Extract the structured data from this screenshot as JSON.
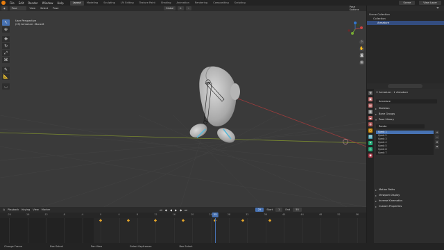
{
  "topbar": {
    "menus": [
      "File",
      "Edit",
      "Render",
      "Window",
      "Help"
    ],
    "workspaces": [
      "Layout",
      "Modeling",
      "Sculpting",
      "UV Editing",
      "Texture Paint",
      "Shading",
      "Animation",
      "Rendering",
      "Compositing",
      "Scripting"
    ],
    "active_workspace": "Layout",
    "scene": "Scene",
    "view_layer": "View Layer"
  },
  "viewport": {
    "mode": "Pose Mode",
    "menus": [
      "View",
      "Select",
      "Pose"
    ],
    "orientation": "Global",
    "view_name": "User Perspective",
    "object_info": "(25) Armature : Bone.8",
    "pose_options": "Pose Options"
  },
  "timeline": {
    "menus": [
      "Playback",
      "Keying",
      "View",
      "Marker"
    ],
    "current_frame": "25",
    "start_label": "Start",
    "start_value": "1",
    "end_label": "End",
    "end_value": "55",
    "ruler": [
      "-20",
      "-16",
      "-12",
      "-8",
      "-4",
      "0",
      "4",
      "8",
      "12",
      "16",
      "20",
      "24",
      "28",
      "32",
      "36",
      "40",
      "44",
      "48",
      "52",
      "56"
    ],
    "keyframes": [
      0,
      6,
      12,
      18,
      25,
      31,
      37
    ]
  },
  "statusbar": {
    "items": [
      "Change Frame",
      "Box Select",
      "Pan View",
      "Select Keyframes",
      "Box Select"
    ]
  },
  "outliner": {
    "header": "Scene Collection",
    "rows": [
      {
        "label": "Scene Collection",
        "indent": 0,
        "selected": false
      },
      {
        "label": "Collection",
        "indent": 1,
        "selected": false
      },
      {
        "label": "Armature",
        "indent": 2,
        "selected": true
      }
    ]
  },
  "properties": {
    "breadcrumb_a": "Armature",
    "breadcrumb_b": "Armature",
    "datablock": "Armature",
    "sections_top": [
      "Skeleton",
      "Bone Groups",
      "Pose Library"
    ],
    "pose_library_name": "Rondo",
    "poses": [
      "Symb 1",
      "Symb 2",
      "Symb 3",
      "Symb 4",
      "Symb 5",
      "Symb 6",
      "Symb 7"
    ],
    "selected_pose": "Symb 1",
    "sections_bottom": [
      "Motion Paths",
      "Viewport Display",
      "Inverse Kinematics",
      "Custom Properties"
    ]
  },
  "colors": {
    "accent": "#4772b3",
    "keyframe": "#e8a82b",
    "playhead": "#4772b3",
    "x_axis": "#9a3c3c",
    "y_axis": "#7a8a2f"
  }
}
